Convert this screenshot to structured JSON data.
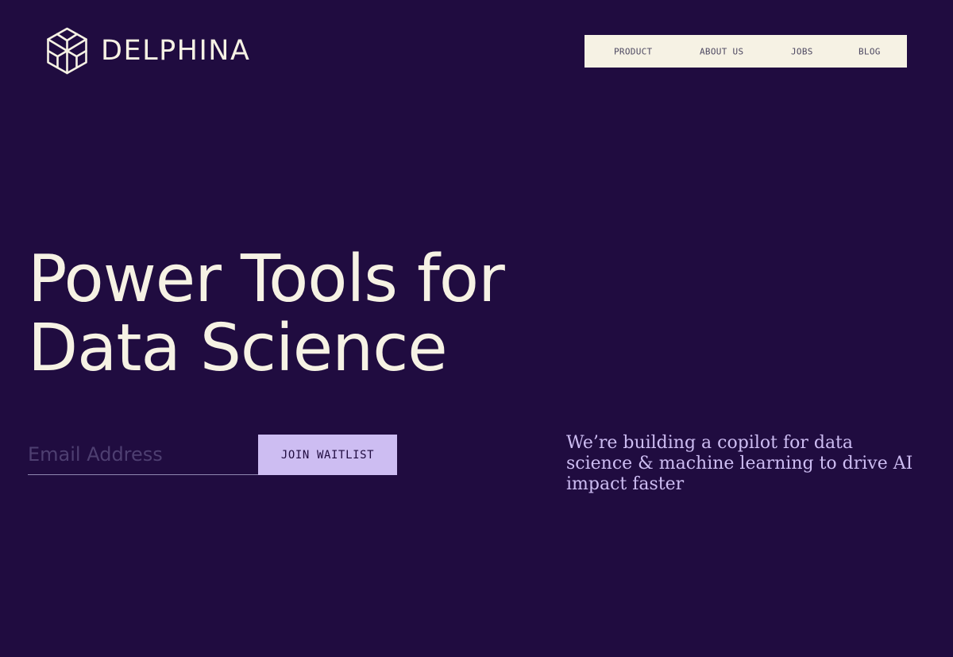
{
  "brand": {
    "name": "DELPHINA",
    "logo_icon": "hexagon-cube-logo-icon"
  },
  "nav": {
    "items": [
      {
        "label": "PRODUCT"
      },
      {
        "label": "ABOUT US"
      },
      {
        "label": "JOBS"
      },
      {
        "label": "BLOG"
      }
    ]
  },
  "hero": {
    "headline_line1": "Power Tools for",
    "headline_line2": "Data Science",
    "email_placeholder": "Email Address",
    "email_value": "",
    "cta_label": "JOIN WAITLIST",
    "tagline": "We’re building a copilot for data science & machine learning to drive AI impact faster"
  },
  "colors": {
    "background": "#200c40",
    "cream": "#f6f2e4",
    "lavender": "#cdbdf2",
    "nav_text": "#4c4760",
    "placeholder": "#4e3f71"
  }
}
